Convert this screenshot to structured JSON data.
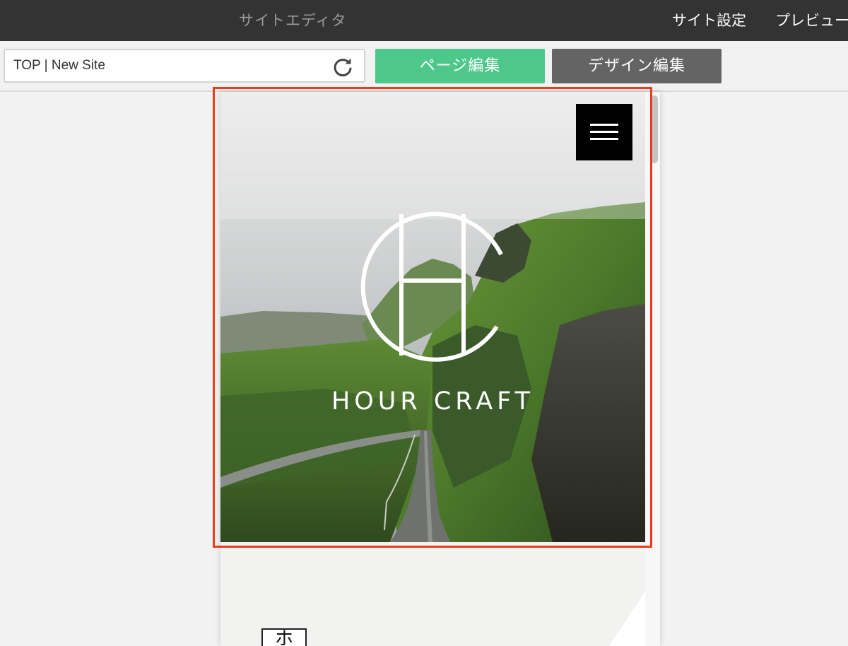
{
  "topbar": {
    "app_title": "サイトエディタ",
    "nav": {
      "site_settings": "サイト設定",
      "preview": "プレビュー"
    }
  },
  "toolbar": {
    "page_select_value": "TOP | New Site",
    "reload_icon": "reload-icon",
    "page_edit_label": "ページ編集",
    "design_edit_label": "デザイン編集"
  },
  "preview": {
    "hero": {
      "logo_text": "HOUR CRAFT",
      "menu_icon": "hamburger-menu-icon",
      "logo_icon": "hour-craft-logo"
    },
    "below_section": {
      "icon_char": "ホ"
    }
  },
  "colors": {
    "topbar_bg": "#333333",
    "page_edit_green": "#4ec88a",
    "design_edit_gray": "#646464",
    "selection_red": "#ee3a1c"
  }
}
